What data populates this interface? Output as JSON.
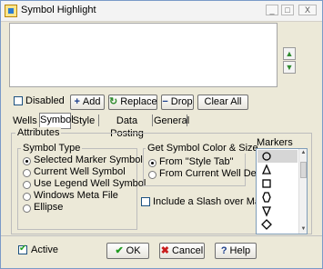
{
  "window": {
    "title": "Symbol Highlight",
    "controls": [
      "_",
      "□",
      "X"
    ]
  },
  "list": {
    "items": [],
    "up_icon": "arrow-up-green",
    "down_icon": "arrow-down-green"
  },
  "toolbar": {
    "disabled_label": "Disabled",
    "disabled_checked": false,
    "add_label": "Add",
    "replace_label": "Replace",
    "drop_label": "Drop",
    "clear_all_label": "Clear All"
  },
  "tabs": [
    {
      "label": "Wells",
      "active": false
    },
    {
      "label": "Symbol",
      "active": true
    },
    {
      "label": "Style",
      "active": false
    },
    {
      "label": "Data Posting",
      "active": false
    },
    {
      "label": "General",
      "active": false
    }
  ],
  "attributes": {
    "title": "Attributes",
    "symbol_type": {
      "title": "Symbol Type",
      "options": [
        {
          "label": "Selected Marker Symbol",
          "checked": true
        },
        {
          "label": "Current Well Symbol",
          "checked": false
        },
        {
          "label": "Use Legend Well Symbol",
          "checked": false
        },
        {
          "label": "Windows Meta File",
          "checked": false
        },
        {
          "label": "Ellipse",
          "checked": false
        }
      ]
    },
    "color_size": {
      "title": "Get Symbol Color & Size",
      "options": [
        {
          "label": "From \"Style Tab\"",
          "checked": true
        },
        {
          "label": "From Current Well Descr.",
          "checked": false
        }
      ]
    },
    "slash_label": "Include a Slash over Marker",
    "slash_checked": false
  },
  "markers": {
    "title": "Markers",
    "items": [
      "circle",
      "triangle",
      "square",
      "hexagon",
      "inverted-triangle",
      "diamond"
    ],
    "selected": "circle"
  },
  "footer": {
    "active_label": "Active",
    "active_checked": true,
    "ok_label": "OK",
    "cancel_label": "Cancel",
    "help_label": "Help"
  }
}
